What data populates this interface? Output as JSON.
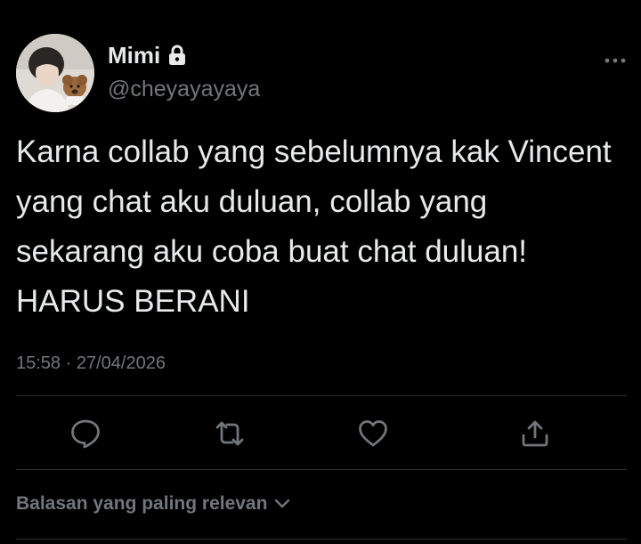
{
  "user": {
    "display_name": "Mimi",
    "handle": "@cheyayayaya",
    "protected_icon": "lock-icon"
  },
  "tweet": {
    "text": "Karna collab yang sebelumnya kak Vincent yang chat aku duluan, collab yang sekarang aku coba buat chat duluan! HARUS BERANI",
    "time": "15:58",
    "separator": "·",
    "date": "27/04/2026"
  },
  "actions": [
    {
      "name": "reply",
      "icon": "speech-bubble-icon"
    },
    {
      "name": "retweet",
      "icon": "retweet-arrows-icon"
    },
    {
      "name": "like",
      "icon": "heart-icon"
    },
    {
      "name": "share",
      "icon": "share-upload-icon"
    }
  ],
  "replies_sort": {
    "label": "Balasan yang paling relevan",
    "icon": "chevron-down-icon"
  },
  "colors": {
    "background": "#000000",
    "primary_text": "#e7e9ea",
    "secondary_text": "#71767b",
    "divider": "#2f3336"
  }
}
